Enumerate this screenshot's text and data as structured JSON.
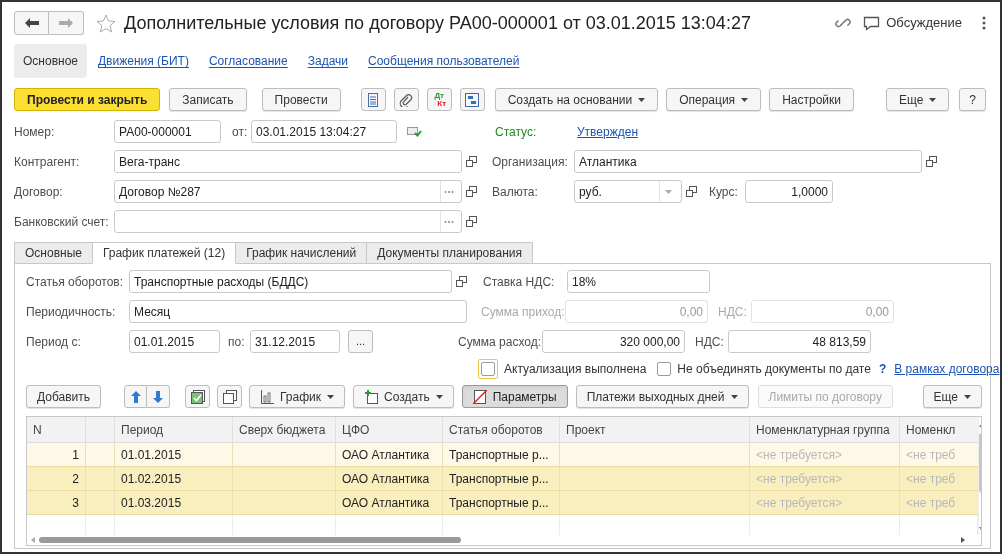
{
  "window": {
    "title": "Дополнительные условия по договору РА00-000001 от 03.01.2015 13:04:27",
    "discussion": "Обсуждение"
  },
  "sections": [
    {
      "label": "Основное",
      "selected": true
    },
    {
      "label": "Движения (БИТ)",
      "selected": false
    },
    {
      "label": "Согласование",
      "selected": false
    },
    {
      "label": "Задачи",
      "selected": false
    },
    {
      "label": "Сообщения пользователей",
      "selected": false
    }
  ],
  "toolbar": [
    {
      "kind": "primary",
      "label": "Провести и закрыть"
    },
    {
      "kind": "button",
      "label": "Записать"
    },
    {
      "kind": "button",
      "label": "Провести"
    },
    {
      "kind": "icon"
    },
    {
      "kind": "icon"
    },
    {
      "kind": "dtkt",
      "top": "Дт",
      "bottom": "Кт"
    },
    {
      "kind": "icon"
    },
    {
      "kind": "menu",
      "label": "Создать на основании"
    },
    {
      "kind": "menu",
      "label": "Операция"
    },
    {
      "kind": "button",
      "label": "Настройки"
    }
  ],
  "toolbar_right": [
    {
      "kind": "menu",
      "label": "Еще"
    },
    {
      "kind": "button",
      "label": "?"
    }
  ],
  "header": {
    "number": {
      "label": "Номер:",
      "value": "РА00-000001"
    },
    "date": {
      "label": "от:",
      "value": "03.01.2015 13:04:27"
    },
    "status": {
      "label": "Статус:",
      "value": "Утвержден"
    },
    "counterparty": {
      "label": "Контрагент:",
      "value": "Вега-транс"
    },
    "organization": {
      "label": "Организация:",
      "value": "Атлантика"
    },
    "contract": {
      "label": "Договор:",
      "value": "Договор №287"
    },
    "currency": {
      "label": "Валюта:",
      "value": "руб."
    },
    "rate": {
      "label": "Курс:",
      "value": "1,0000"
    },
    "bank_account": {
      "label": "Банковский счет:"
    }
  },
  "tabs": [
    {
      "label": "Основные",
      "selected": false
    },
    {
      "label": "График платежей (12)",
      "selected": true
    },
    {
      "label": "График начислений",
      "selected": false
    },
    {
      "label": "Документы планирования",
      "selected": false
    }
  ],
  "payments": {
    "article": {
      "label": "Статья оборотов:",
      "value": "Транспортные расходы (БДДС)"
    },
    "vat_rate": {
      "label": "Ставка НДС:",
      "value": "18%"
    },
    "periodicity": {
      "label": "Периодичность:",
      "value": "Месяц"
    },
    "period_from": {
      "label": "Период с:",
      "value": "01.01.2015"
    },
    "period_to": {
      "label": "по:",
      "value": "31.12.2015"
    },
    "period_button": "...",
    "income": {
      "label": "Сумма приход:",
      "value": "0,00",
      "disabled": true
    },
    "income_vat": {
      "label": "НДС:",
      "value": "0,00",
      "disabled": true
    },
    "expense": {
      "label": "Сумма расход:",
      "value": "320 000,00",
      "disabled": false
    },
    "expense_vat": {
      "label": "НДС:",
      "value": "48 813,59",
      "disabled": false
    },
    "actualized": {
      "label": "Актуализация выполнена",
      "checked": false
    },
    "no_merge": {
      "label": "Не объединять документы по дате",
      "checked": false
    },
    "help": "?",
    "link": "В рамках договора"
  },
  "table_toolbar": [
    {
      "kind": "button",
      "label": "Добавить",
      "disabled": false,
      "pressed": false
    },
    {
      "kind": "arrows",
      "disabled": false,
      "pressed": false
    },
    {
      "kind": "icon",
      "disabled": false,
      "pressed": false
    },
    {
      "kind": "icon",
      "disabled": false,
      "pressed": false
    },
    {
      "kind": "menu",
      "label": "График",
      "disabled": false,
      "pressed": false
    },
    {
      "kind": "menu",
      "label": "Создать",
      "disabled": false,
      "pressed": false
    },
    {
      "kind": "button",
      "label": "Параметры",
      "disabled": false,
      "pressed": true
    },
    {
      "kind": "menu",
      "label": "Платежи выходных дней",
      "disabled": false,
      "pressed": false
    },
    {
      "kind": "button",
      "label": "Лимиты по договору",
      "disabled": true,
      "pressed": false
    }
  ],
  "table_toolbar_right": {
    "label": "Еще"
  },
  "table": {
    "columns": [
      "N",
      "Период",
      "Сверх бюджета",
      "ЦФО",
      "Статья оборотов",
      "Проект",
      "Номенклатурная группа",
      "Номенкл"
    ],
    "rows": [
      {
        "n": "1",
        "period": "01.01.2015",
        "cfo": "ОАО Атлантика",
        "article": "Транспортные р...",
        "group": "<не требуется>",
        "nomenclature": "<не треб",
        "selected": false
      },
      {
        "n": "2",
        "period": "01.02.2015",
        "cfo": "ОАО Атлантика",
        "article": "Транспортные р...",
        "group": "<не требуется>",
        "nomenclature": "<не треб",
        "selected": true
      },
      {
        "n": "3",
        "period": "01.03.2015",
        "cfo": "ОАО Атлантика",
        "article": "Транспортные р...",
        "group": "<не требуется>",
        "nomenclature": "<не треб",
        "selected": true
      }
    ]
  }
}
